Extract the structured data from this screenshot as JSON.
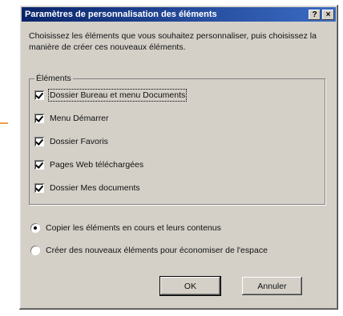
{
  "dialog": {
    "title": "Paramètres de personnalisation des éléments",
    "help_button": "?",
    "close_button": "×"
  },
  "description": "Choisissez les éléments que vous souhaitez personnaliser, puis choisissez la manière de créer ces nouveaux éléments.",
  "items_group": {
    "label": "Éléments",
    "items": [
      {
        "label": "Dossier Bureau et menu Documents",
        "checked": true
      },
      {
        "label": "Menu Démarrer",
        "checked": true
      },
      {
        "label": "Dossier Favoris",
        "checked": true
      },
      {
        "label": "Pages Web téléchargées",
        "checked": true
      },
      {
        "label": "Dossier Mes documents",
        "checked": true
      }
    ]
  },
  "options": [
    {
      "label": "Copier les éléments en cours et leurs contenus",
      "selected": true
    },
    {
      "label": "Créer des nouveaux éléments pour économiser de l'espace",
      "selected": false
    }
  ],
  "buttons": {
    "ok": "OK",
    "cancel": "Annuler"
  }
}
